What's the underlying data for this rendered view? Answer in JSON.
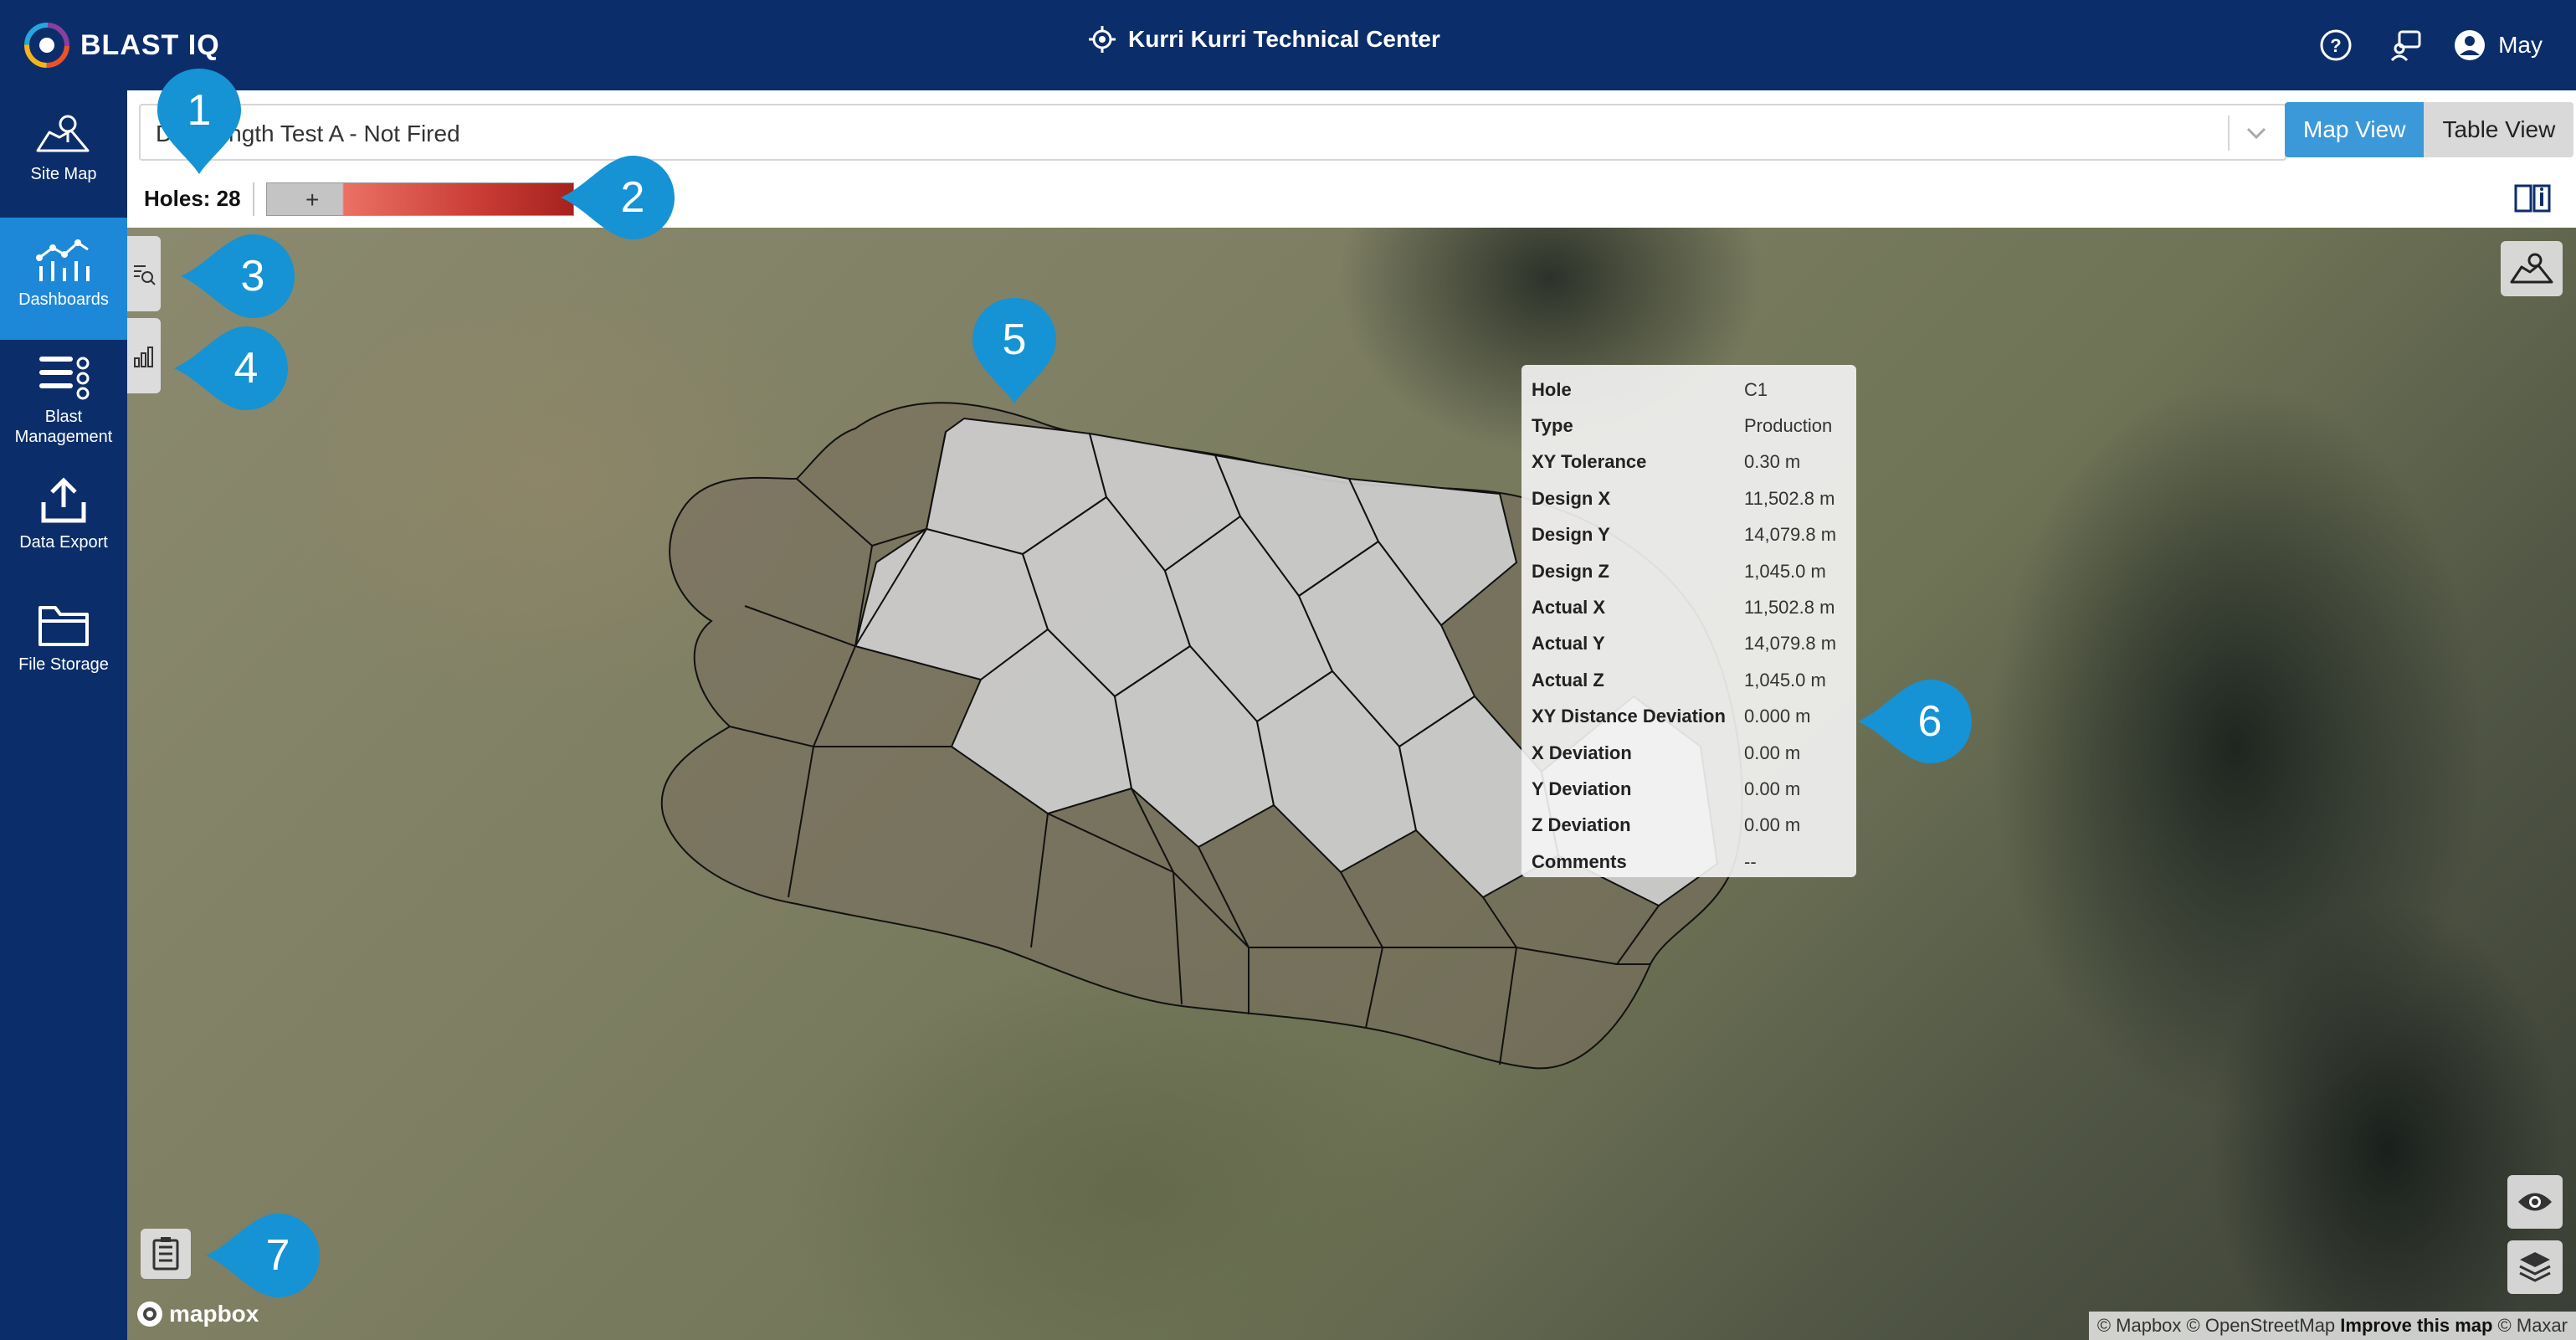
{
  "app": {
    "logo_text": "BLAST IQ",
    "site_title": "Kurri Kurri Technical Center",
    "user_name": "May"
  },
  "sidebar": {
    "items": [
      {
        "label": "Site Map",
        "icon": "site-map-icon"
      },
      {
        "label": "Dashboards",
        "icon": "dashboards-icon",
        "active": true
      },
      {
        "label": "Blast Management",
        "icon": "blast-management-icon"
      },
      {
        "label": "Data Export",
        "icon": "data-export-icon"
      },
      {
        "label": "File Storage",
        "icon": "file-storage-icon"
      }
    ]
  },
  "header": {
    "blast_select_value": "Drill Length Test A - Not Fired",
    "views": [
      "Map View",
      "Table View"
    ],
    "active_view": "Map View",
    "holes_label": "Holes: 28",
    "legend_plus": "+"
  },
  "tooltip": {
    "rows": [
      {
        "key": "Hole",
        "value": "C1"
      },
      {
        "key": "Type",
        "value": "Production"
      },
      {
        "key": "XY Tolerance",
        "value": "0.30 m"
      },
      {
        "key": "Design X",
        "value": "11,502.8 m"
      },
      {
        "key": "Design Y",
        "value": "14,079.8 m"
      },
      {
        "key": "Design Z",
        "value": "1,045.0 m"
      },
      {
        "key": "Actual X",
        "value": "11,502.8 m"
      },
      {
        "key": "Actual Y",
        "value": "14,079.8 m"
      },
      {
        "key": "Actual Z",
        "value": "1,045.0 m"
      },
      {
        "key": "XY Distance Deviation",
        "value": "0.000 m"
      },
      {
        "key": "X Deviation",
        "value": "0.00 m"
      },
      {
        "key": "Y Deviation",
        "value": "0.00 m"
      },
      {
        "key": "Z Deviation",
        "value": "0.00 m"
      },
      {
        "key": "Comments",
        "value": "--"
      }
    ]
  },
  "callouts": [
    "1",
    "2",
    "3",
    "4",
    "5",
    "6",
    "7"
  ],
  "map": {
    "mapbox_label": "mapbox",
    "attribution_1": "© Mapbox © OpenStreetMap ",
    "attribution_bold": "Improve this map",
    "attribution_2": " © Maxar"
  },
  "colors": {
    "navy": "#0b2e6b",
    "accent": "#1e88d8",
    "callout": "#1593d4",
    "legend_grey": "#c4c4c4",
    "legend_red": "#a5221d"
  }
}
